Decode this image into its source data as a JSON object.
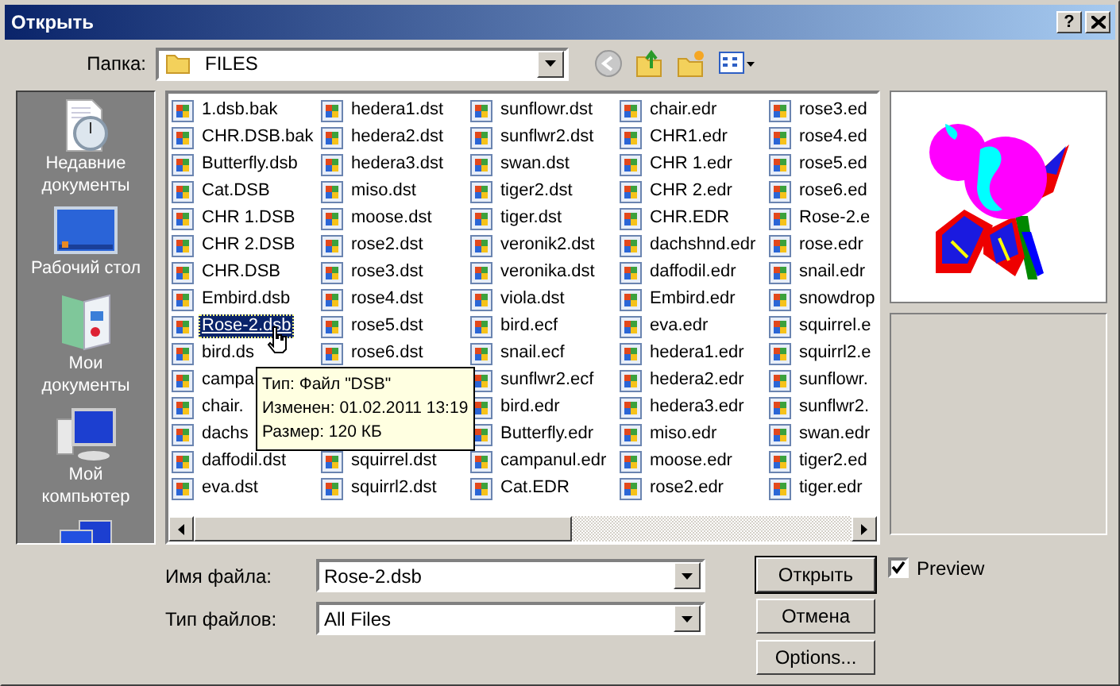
{
  "window": {
    "title": "Открыть",
    "help_button": "?"
  },
  "folder_bar": {
    "label": "Папка:",
    "value": "FILES"
  },
  "places": [
    {
      "kind": "recent",
      "label": "Недавние документы"
    },
    {
      "kind": "desktop",
      "label": "Рабочий стол"
    },
    {
      "kind": "documents",
      "label": "Мои документы"
    },
    {
      "kind": "computer",
      "label": "Мой компьютер"
    },
    {
      "kind": "network"
    }
  ],
  "file_columns": [
    [
      {
        "name": "1.dsb.bak",
        "selected": false
      },
      {
        "name": "CHR.DSB.bak",
        "selected": false
      },
      {
        "name": "Butterfly.dsb",
        "selected": false
      },
      {
        "name": "Cat.DSB",
        "selected": false
      },
      {
        "name": "CHR 1.DSB",
        "selected": false
      },
      {
        "name": "CHR 2.DSB",
        "selected": false
      },
      {
        "name": "CHR.DSB",
        "selected": false
      },
      {
        "name": "Embird.dsb",
        "selected": false
      },
      {
        "name": "Rose-2.dsb",
        "selected": true
      },
      {
        "name": "bird.ds",
        "selected": false
      },
      {
        "name": "campa",
        "selected": false
      },
      {
        "name": "chair.",
        "selected": false
      },
      {
        "name": "dachs",
        "selected": false
      },
      {
        "name": "daffodil.dst",
        "selected": false
      },
      {
        "name": "eva.dst",
        "selected": false
      }
    ],
    [
      {
        "name": "hedera1.dst",
        "selected": false
      },
      {
        "name": "hedera2.dst",
        "selected": false
      },
      {
        "name": "hedera3.dst",
        "selected": false
      },
      {
        "name": "miso.dst",
        "selected": false
      },
      {
        "name": "moose.dst",
        "selected": false
      },
      {
        "name": "rose2.dst",
        "selected": false
      },
      {
        "name": "rose3.dst",
        "selected": false
      },
      {
        "name": "rose4.dst",
        "selected": false
      },
      {
        "name": "rose5.dst",
        "selected": false
      },
      {
        "name": "rose6.dst",
        "selected": false
      },
      {
        "name": "squirrel.dst",
        "selected": false
      },
      {
        "name": "squirrl2.dst",
        "selected": false
      }
    ],
    [
      {
        "name": "sunflowr.dst",
        "selected": false
      },
      {
        "name": "sunflwr2.dst",
        "selected": false
      },
      {
        "name": "swan.dst",
        "selected": false
      },
      {
        "name": "tiger2.dst",
        "selected": false
      },
      {
        "name": "tiger.dst",
        "selected": false
      },
      {
        "name": "veronik2.dst",
        "selected": false
      },
      {
        "name": "veronika.dst",
        "selected": false
      },
      {
        "name": "viola.dst",
        "selected": false
      },
      {
        "name": "bird.ecf",
        "selected": false
      },
      {
        "name": "snail.ecf",
        "selected": false
      },
      {
        "name": "sunflwr2.ecf",
        "selected": false
      },
      {
        "name": "bird.edr",
        "selected": false
      },
      {
        "name": "Butterfly.edr",
        "selected": false
      },
      {
        "name": "campanul.edr",
        "selected": false
      },
      {
        "name": "Cat.EDR",
        "selected": false
      }
    ],
    [
      {
        "name": "chair.edr",
        "selected": false
      },
      {
        "name": "CHR1.edr",
        "selected": false
      },
      {
        "name": "CHR 1.edr",
        "selected": false
      },
      {
        "name": "CHR 2.edr",
        "selected": false
      },
      {
        "name": "CHR.EDR",
        "selected": false
      },
      {
        "name": "dachshnd.edr",
        "selected": false
      },
      {
        "name": "daffodil.edr",
        "selected": false
      },
      {
        "name": "Embird.edr",
        "selected": false
      },
      {
        "name": "eva.edr",
        "selected": false
      },
      {
        "name": "hedera1.edr",
        "selected": false
      },
      {
        "name": "hedera2.edr",
        "selected": false
      },
      {
        "name": "hedera3.edr",
        "selected": false
      },
      {
        "name": "miso.edr",
        "selected": false
      },
      {
        "name": "moose.edr",
        "selected": false
      },
      {
        "name": "rose2.edr",
        "selected": false
      }
    ],
    [
      {
        "name": "rose3.ed",
        "selected": false
      },
      {
        "name": "rose4.ed",
        "selected": false
      },
      {
        "name": "rose5.ed",
        "selected": false
      },
      {
        "name": "rose6.ed",
        "selected": false
      },
      {
        "name": "Rose-2.e",
        "selected": false
      },
      {
        "name": "rose.edr",
        "selected": false
      },
      {
        "name": "snail.edr",
        "selected": false
      },
      {
        "name": "snowdrop",
        "selected": false
      },
      {
        "name": "squirrel.e",
        "selected": false
      },
      {
        "name": "squirrl2.e",
        "selected": false
      },
      {
        "name": "sunflowr.",
        "selected": false
      },
      {
        "name": "sunflwr2.",
        "selected": false
      },
      {
        "name": "swan.edr",
        "selected": false
      },
      {
        "name": "tiger2.ed",
        "selected": false
      },
      {
        "name": "tiger.edr",
        "selected": false
      }
    ]
  ],
  "tooltip": {
    "lines": [
      "Тип: Файл \"DSB\"",
      "Изменен: 01.02.2011 13:19",
      "Размер: 120 КБ"
    ]
  },
  "file_name": {
    "label": "Имя файла:",
    "value": "Rose-2.dsb"
  },
  "file_type": {
    "label": "Тип файлов:",
    "value": "All Files"
  },
  "buttons": [
    "Открыть",
    "Отмена",
    "Options..."
  ],
  "preview": {
    "label": "Preview",
    "checked": true
  }
}
